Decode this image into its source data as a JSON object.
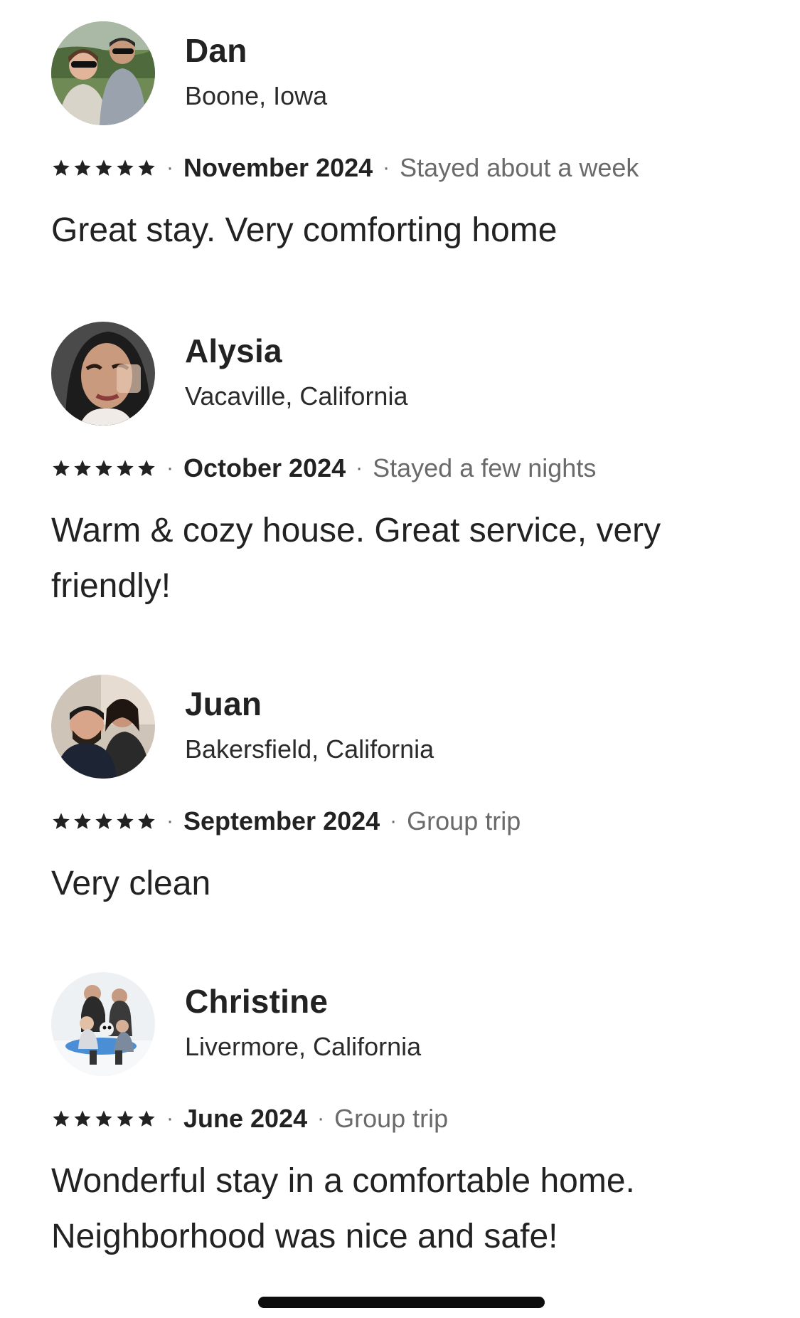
{
  "reviews": [
    {
      "name": "Dan",
      "location": "Boone, Iowa",
      "rating": 5,
      "date": "November 2024",
      "stay": "Stayed about a week",
      "text": "Great stay. Very comforting home",
      "avatar_icon": "photo-couple-outdoors-icon"
    },
    {
      "name": "Alysia",
      "location": "Vacaville, California",
      "rating": 5,
      "date": "October 2024",
      "stay": "Stayed a few nights",
      "text": "Warm & cozy house. Great service, very friendly!",
      "avatar_icon": "photo-selfie-icon"
    },
    {
      "name": "Juan",
      "location": "Bakersfield, California",
      "rating": 5,
      "date": "September 2024",
      "stay": "Group trip",
      "text": "Very clean",
      "avatar_icon": "photo-couple-icon"
    },
    {
      "name": "Christine",
      "location": "Livermore, California",
      "rating": 5,
      "date": "June 2024",
      "stay": "Group trip",
      "text": "Wonderful stay in a comfortable home. Neighborhood was nice and safe!",
      "avatar_icon": "photo-family-snow-icon"
    }
  ],
  "separator": "·",
  "colors": {
    "text_primary": "#222222",
    "text_secondary": "#6a6a6a",
    "star": "#222222"
  }
}
